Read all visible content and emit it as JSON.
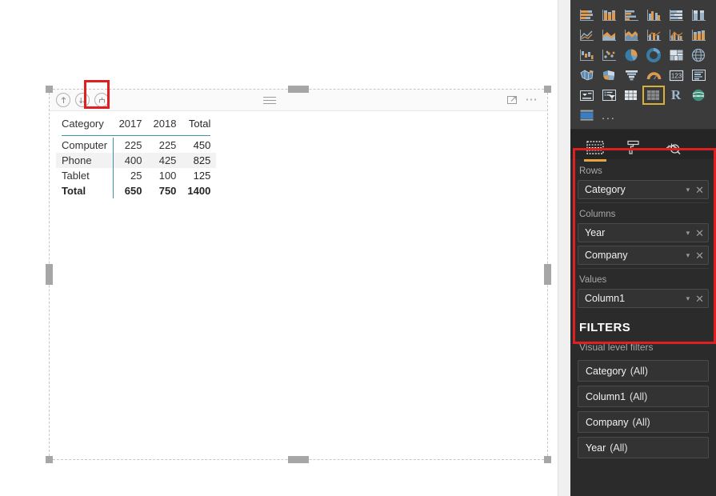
{
  "visual": {
    "header": {
      "drill_up_icon": "drill-up-arrow-icon",
      "drill_down_icon": "drill-down-arrow-icon",
      "expand_all_icon": "expand-all-down-icon",
      "drag_handle_icon": "drag-handle-icon",
      "focus_mode_icon": "focus-mode-icon",
      "more_options_icon": "more-options-ellipsis-icon"
    },
    "matrix": {
      "type": "table",
      "columns": [
        "Category",
        "2017",
        "2018",
        "Total"
      ],
      "rows": [
        {
          "category": "Computer",
          "y2017": "225",
          "y2018": "225",
          "total": "450"
        },
        {
          "category": "Phone",
          "y2017": "400",
          "y2018": "425",
          "total": "825"
        },
        {
          "category": "Tablet",
          "y2017": "25",
          "y2018": "100",
          "total": "125"
        }
      ],
      "grand_total": {
        "category": "Total",
        "y2017": "650",
        "y2018": "750",
        "total": "1400"
      },
      "accent_color": "#3c93a3",
      "alt_row_color": "#f2f2f2"
    }
  },
  "right_pane": {
    "gallery": {
      "selected_visual": "matrix",
      "more_label": "...",
      "r_script_label": "R",
      "icons": [
        "stacked-bar-chart-icon",
        "stacked-column-chart-icon",
        "clustered-bar-chart-icon",
        "clustered-column-chart-icon",
        "hundred-percent-stacked-bar-icon",
        "hundred-percent-stacked-column-icon",
        "line-chart-icon",
        "area-chart-icon",
        "stacked-area-chart-icon",
        "line-and-stacked-column-icon",
        "line-and-clustered-column-icon",
        "ribbon-chart-icon",
        "waterfall-chart-icon",
        "scatter-chart-icon",
        "pie-chart-icon",
        "donut-chart-icon",
        "treemap-icon",
        "map-icon",
        "filled-map-icon",
        "shape-map-icon",
        "funnel-chart-icon",
        "gauge-chart-icon",
        "card-icon",
        "multi-row-card-icon",
        "kpi-icon",
        "slicer-icon",
        "table-icon",
        "matrix-icon",
        "r-script-visual-icon",
        "arcgis-map-icon",
        "paginated-report-icon",
        "more-visuals-icon"
      ]
    },
    "well_tabs": [
      {
        "name": "fields",
        "icon": "fields-grid-icon",
        "active": true
      },
      {
        "name": "format",
        "icon": "paint-roller-icon",
        "active": false
      },
      {
        "name": "analytics",
        "icon": "analytics-magnifier-icon",
        "active": false
      }
    ],
    "wells": [
      {
        "label": "Rows",
        "fields": [
          {
            "name": "Category",
            "chevron": "▾",
            "remove": "✕"
          }
        ]
      },
      {
        "label": "Columns",
        "fields": [
          {
            "name": "Year",
            "chevron": "▾",
            "remove": "✕"
          },
          {
            "name": "Company",
            "chevron": "▾",
            "remove": "✕"
          }
        ]
      },
      {
        "label": "Values",
        "fields": [
          {
            "name": "Column1",
            "chevron": "▾",
            "remove": "✕"
          }
        ]
      }
    ],
    "filters": {
      "title": "FILTERS",
      "subtitle": "Visual level filters",
      "items": [
        {
          "field": "Category",
          "value": "(All)"
        },
        {
          "field": "Column1",
          "value": "(All)"
        },
        {
          "field": "Company",
          "value": "(All)"
        },
        {
          "field": "Year",
          "value": "(All)"
        }
      ]
    }
  },
  "annotations": {
    "drill_button_highlight": "expand-all-button-highlight",
    "field_wells_highlight": "field-wells-highlight",
    "color": "#e02020"
  }
}
